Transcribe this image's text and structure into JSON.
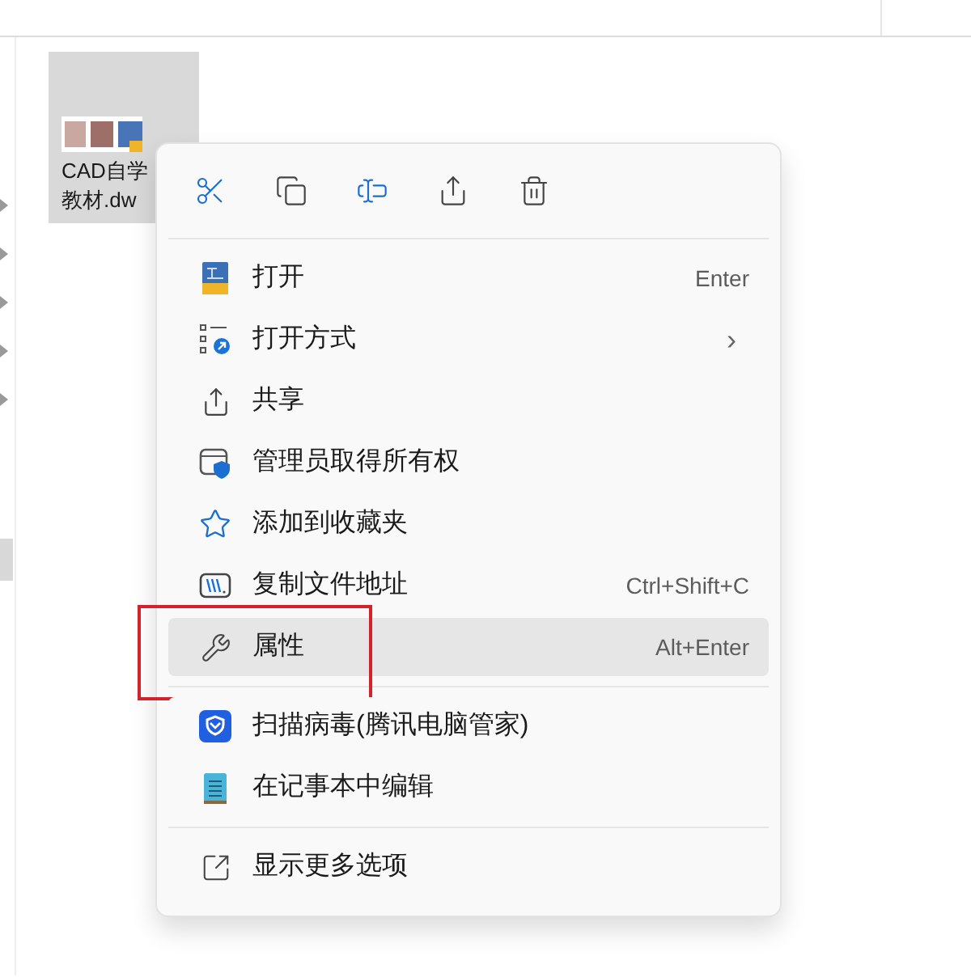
{
  "file_tile": {
    "name_lines": [
      "CAD自学",
      "教材.dw"
    ],
    "selected": true
  },
  "context_menu": {
    "groups": [
      [
        {
          "label": "打开",
          "shortcut": "Enter",
          "selected": false
        },
        {
          "label": "打开方式",
          "submenu": true,
          "submenu_glyph": "›",
          "selected": false
        },
        {
          "label": "共享",
          "selected": false
        },
        {
          "label": "管理员取得所有权",
          "selected": false
        },
        {
          "label": "添加到收藏夹",
          "selected": false
        },
        {
          "label": "复制文件地址",
          "shortcut": "Ctrl+Shift+C",
          "selected": false
        },
        {
          "label": "属性",
          "shortcut": "Alt+Enter",
          "selected": true,
          "annotated": true
        }
      ],
      [
        {
          "label": "扫描病毒(腾讯电脑管家)",
          "selected": false
        },
        {
          "label": "在记事本中编辑",
          "selected": false
        }
      ],
      [
        {
          "label": "显示更多选项",
          "selected": false
        }
      ]
    ]
  }
}
